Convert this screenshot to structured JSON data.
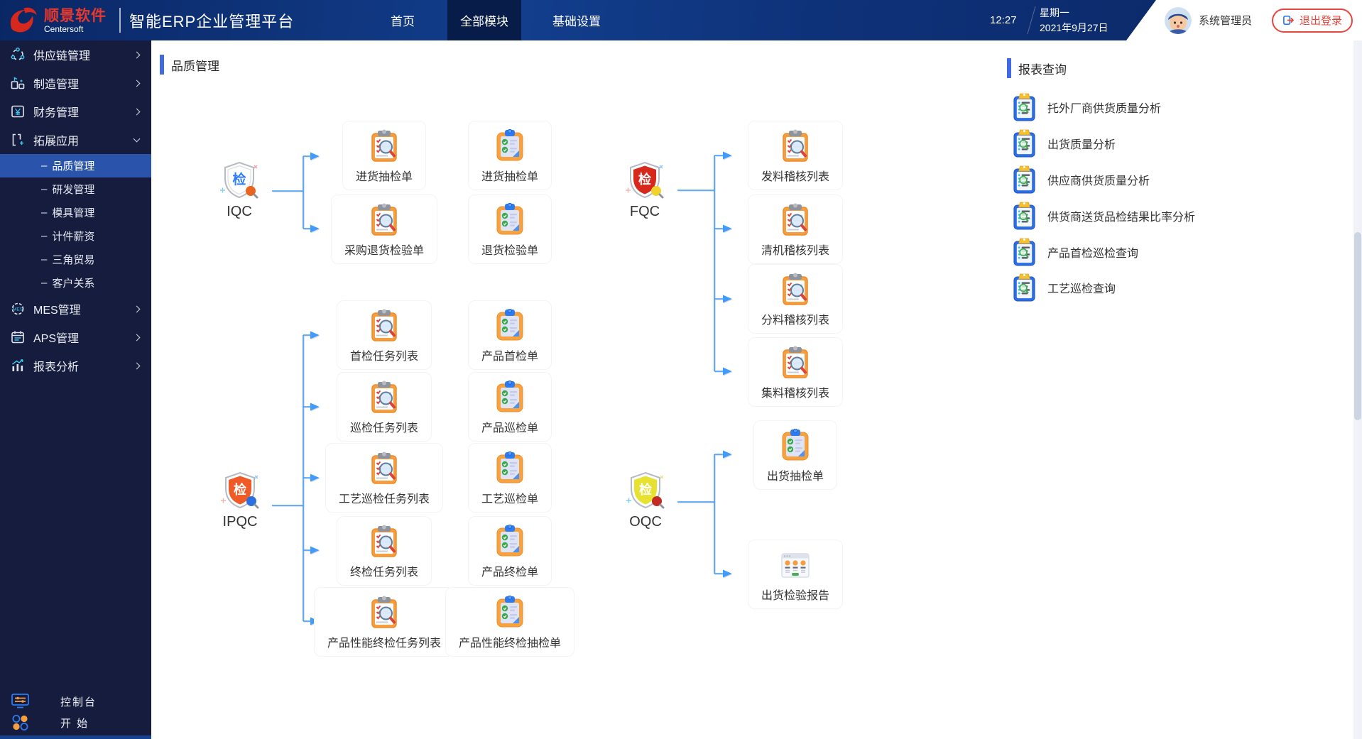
{
  "navbar": {
    "logo_title": "顺景软件",
    "logo_subtitle": "Centersoft",
    "app_title": "智能ERP企业管理平台",
    "tabs": [
      {
        "label": "首页"
      },
      {
        "label": "全部模块"
      },
      {
        "label": "基础设置"
      }
    ],
    "time": "12:27",
    "weekday": "星期一",
    "date": "2021年9月27日",
    "user": "系统管理员",
    "logout_label": "退出登录"
  },
  "sidebar": {
    "sub_prefix": "–",
    "mes_icon_text": "MES",
    "groups_top": [
      {
        "label": "供应链管理"
      },
      {
        "label": "制造管理"
      },
      {
        "label": "财务管理"
      },
      {
        "label": "拓展应用"
      }
    ],
    "sub_items": [
      {
        "label": "品质管理"
      },
      {
        "label": "研发管理"
      },
      {
        "label": "模具管理"
      },
      {
        "label": "计件薪资"
      },
      {
        "label": "三角贸易"
      },
      {
        "label": "客户关系"
      }
    ],
    "groups_bottom": [
      {
        "label": "MES管理"
      },
      {
        "label": "APS管理"
      },
      {
        "label": "报表分析"
      }
    ],
    "console_label": "控制台",
    "start_label": "开 始"
  },
  "main": {
    "title": "品质管理",
    "flow": {
      "shield_glyph": "检",
      "iqc": {
        "label": "IQC",
        "col1": [
          "进货抽检单",
          "采购退货检验单"
        ],
        "col2": [
          "进货抽检单",
          "退货检验单"
        ]
      },
      "ipqc": {
        "label": "IPQC",
        "col1": [
          "首检任务列表",
          "巡检任务列表",
          "工艺巡检任务列表",
          "终检任务列表",
          "产品性能终检任务列表"
        ],
        "col2": [
          "产品首检单",
          "产品巡检单",
          "工艺巡检单",
          "产品终检单",
          "产品性能终检抽检单"
        ]
      },
      "fqc": {
        "label": "FQC",
        "items": [
          "发料稽核列表",
          "清机稽核列表",
          "分料稽核列表",
          "集料稽核列表"
        ]
      },
      "oqc": {
        "label": "OQC",
        "items": [
          "出货抽检单",
          "出货检验报告"
        ]
      }
    }
  },
  "report_panel": {
    "title": "报表查询",
    "items": [
      "托外厂商供货质量分析",
      "出货质量分析",
      "供应商供货质量分析",
      "供货商送货品检结果比率分析",
      "产品首检巡检查询",
      "工艺巡检查询"
    ]
  }
}
